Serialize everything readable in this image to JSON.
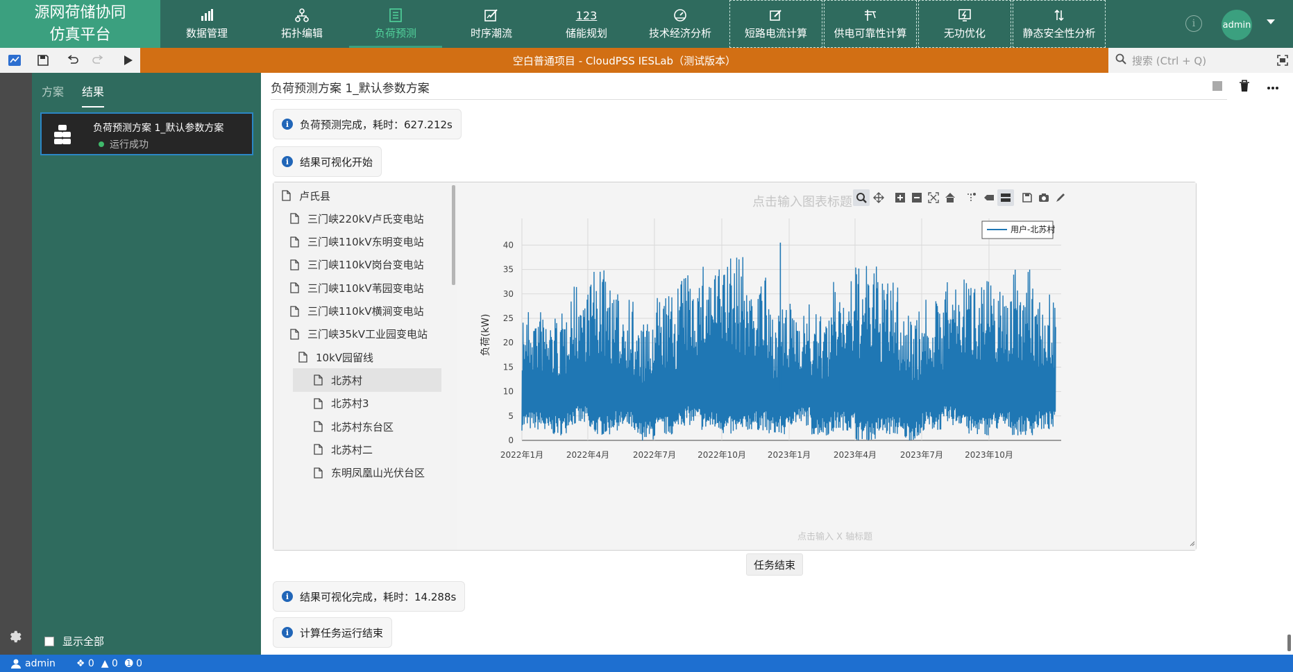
{
  "brand": {
    "line1": "源网荷储协同",
    "line2": "仿真平台"
  },
  "nav": [
    {
      "label": "数据管理",
      "icon": "bar-chart-icon"
    },
    {
      "label": "拓扑编辑",
      "icon": "topology-icon"
    },
    {
      "label": "负荷预测",
      "icon": "document-list-icon",
      "active": true
    },
    {
      "label": "时序潮流",
      "icon": "edit-flow-icon"
    },
    {
      "label": "储能规划",
      "icon": "numbers-icon",
      "icon_text": "123"
    },
    {
      "label": "技术经济分析",
      "icon": "gauge-icon"
    },
    {
      "label": "短路电流计算",
      "icon": "edit-square-icon"
    },
    {
      "label": "供电可靠性计算",
      "icon": "pole-icon"
    },
    {
      "label": "无功优化",
      "icon": "power-icon"
    },
    {
      "label": "静态安全性分析",
      "icon": "updown-arrows-icon"
    }
  ],
  "user": {
    "avatar": "admin",
    "info": "i"
  },
  "titlebar": "空白普通项目 - CloudPSS IESLab（测试版本）",
  "search": {
    "placeholder": "搜索 (Ctrl + Q)"
  },
  "sidebar": {
    "tabs": [
      "方案",
      "结果"
    ],
    "active_tab": "结果",
    "run": {
      "title": "负荷预测方案 1_默认参数方案",
      "status": "运行成功"
    },
    "show_all": "显示全部"
  },
  "main": {
    "heading": "负荷预测方案 1_默认参数方案",
    "messages": [
      {
        "icon": "i",
        "text": "负荷预测完成，耗时：627.212s"
      },
      {
        "icon": "i",
        "text": "结果可视化开始"
      },
      {
        "icon": "i",
        "text": "结果可视化完成，耗时：14.288s"
      },
      {
        "icon": "i",
        "text": "计算任务运行结束"
      }
    ],
    "end_button": "任务结束"
  },
  "tree": [
    {
      "label": "卢氏县",
      "level": 0
    },
    {
      "label": "三门峡220kV卢氏变电站",
      "level": 1
    },
    {
      "label": "三门峡110kV东明变电站",
      "level": 1
    },
    {
      "label": "三门峡110kV岗台变电站",
      "level": 1
    },
    {
      "label": "三门峡110kV苇园变电站",
      "level": 1
    },
    {
      "label": "三门峡110kV横涧变电站",
      "level": 1
    },
    {
      "label": "三门峡35kV工业园变电站",
      "level": 1
    },
    {
      "label": "10kV园留线",
      "level": 2
    },
    {
      "label": "北苏村",
      "level": 3,
      "selected": true
    },
    {
      "label": "北苏村3",
      "level": 3
    },
    {
      "label": "北苏村东台区",
      "level": 3
    },
    {
      "label": "北苏村二",
      "level": 3
    },
    {
      "label": "东明凤凰山光伏台区",
      "level": 3
    }
  ],
  "chart_toolbar": [
    "zoom-icon",
    "pan-icon",
    "zoom-in-icon",
    "zoom-out-icon",
    "autoscale-icon",
    "reset-home-icon",
    "spike-lines-icon",
    "hover-closest-icon",
    "hover-compare-icon",
    "save-icon",
    "camera-icon",
    "edit-pencil-icon"
  ],
  "chart_data": {
    "type": "line",
    "title_placeholder": "点击输入图表标题",
    "xlabel_placeholder": "点击输入 X 轴标题",
    "ylabel": "负荷(kW)",
    "legend": "用户-北苏村",
    "legend_position": "top-right",
    "grid": true,
    "line_color": "#1f77b4",
    "ylim": [
      0,
      42
    ],
    "yticks": [
      0,
      5,
      10,
      15,
      20,
      25,
      30,
      35,
      40
    ],
    "x_range": [
      "2022-01-01",
      "2023-12-31"
    ],
    "xticks": [
      "2022年1月",
      "2022年4月",
      "2022年7月",
      "2022年10月",
      "2023年1月",
      "2023年4月",
      "2023年7月",
      "2023年10月"
    ],
    "series": [
      {
        "name": "用户-北苏村",
        "x_start": "2022-01-01",
        "x_end": "2023-12-31",
        "band_low": [
          2,
          1,
          3,
          1,
          2,
          0,
          1,
          3,
          2,
          1,
          2,
          1,
          3,
          1,
          2,
          0,
          1,
          0,
          2,
          3,
          1,
          2,
          1,
          2
        ],
        "band_high": [
          27,
          26,
          32,
          35,
          30,
          24,
          30,
          34,
          36,
          38,
          34,
          27,
          28,
          26,
          33,
          36,
          33,
          27,
          29,
          33,
          35,
          32,
          35,
          30
        ],
        "peak": 40.5
      }
    ]
  }
}
